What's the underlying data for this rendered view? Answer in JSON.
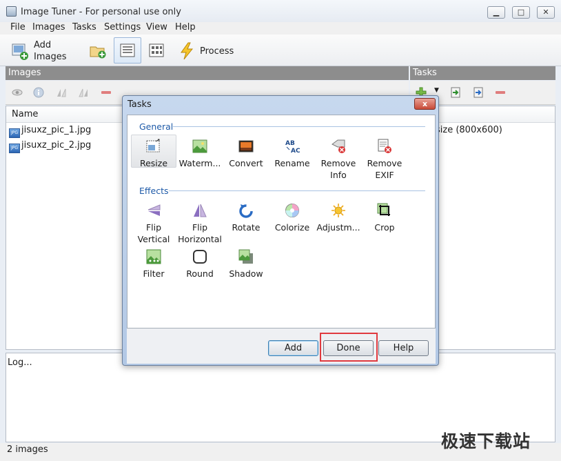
{
  "window": {
    "title": "Image Tuner - For personal use only"
  },
  "menu": [
    "File",
    "Images",
    "Tasks",
    "Settings",
    "View",
    "Help"
  ],
  "toolbar": {
    "add_images": "Add\nImages",
    "add_images_line1": "Add",
    "add_images_line2": "Images",
    "process": "Process"
  },
  "panels": {
    "images": "Images",
    "tasks": "Tasks"
  },
  "images_list": {
    "column": "Name",
    "files": [
      "jisuxz_pic_1.jpg",
      "jisuxz_pic_2.jpg"
    ]
  },
  "tasks_list": {
    "item_partial": "size (800x600)"
  },
  "log": {
    "text": "Log..."
  },
  "status": {
    "text": "2 images"
  },
  "dialog": {
    "title": "Tasks",
    "close": "x",
    "general_label": "General",
    "effects_label": "Effects",
    "general": [
      {
        "line1": "Resize",
        "line2": "",
        "icon": "resize-icon"
      },
      {
        "line1": "Waterm...",
        "line2": "",
        "icon": "watermark-icon"
      },
      {
        "line1": "Convert",
        "line2": "",
        "icon": "convert-icon"
      },
      {
        "line1": "Rename",
        "line2": "",
        "icon": "rename-icon"
      },
      {
        "line1": "Remove",
        "line2": "Info",
        "icon": "remove-info-icon"
      },
      {
        "line1": "Remove",
        "line2": "EXIF",
        "icon": "remove-exif-icon"
      }
    ],
    "effects": [
      {
        "line1": "Flip",
        "line2": "Vertical",
        "icon": "flip-vertical-icon"
      },
      {
        "line1": "Flip",
        "line2": "Horizontal",
        "icon": "flip-horizontal-icon"
      },
      {
        "line1": "Rotate",
        "line2": "",
        "icon": "rotate-icon"
      },
      {
        "line1": "Colorize",
        "line2": "",
        "icon": "colorize-icon"
      },
      {
        "line1": "Adjustm...",
        "line2": "",
        "icon": "adjustments-icon"
      },
      {
        "line1": "Crop",
        "line2": "",
        "icon": "crop-icon"
      },
      {
        "line1": "Filter",
        "line2": "",
        "icon": "filter-icon"
      },
      {
        "line1": "Round",
        "line2": "",
        "icon": "round-icon"
      },
      {
        "line1": "Shadow",
        "line2": "",
        "icon": "shadow-icon"
      }
    ],
    "buttons": {
      "add": "Add",
      "done": "Done",
      "help": "Help"
    }
  },
  "watermark": "极速下载站",
  "colors": {
    "accent": "#1e5aa8",
    "highlight": "#e0393e",
    "panel_header": "#8d8d8d"
  }
}
